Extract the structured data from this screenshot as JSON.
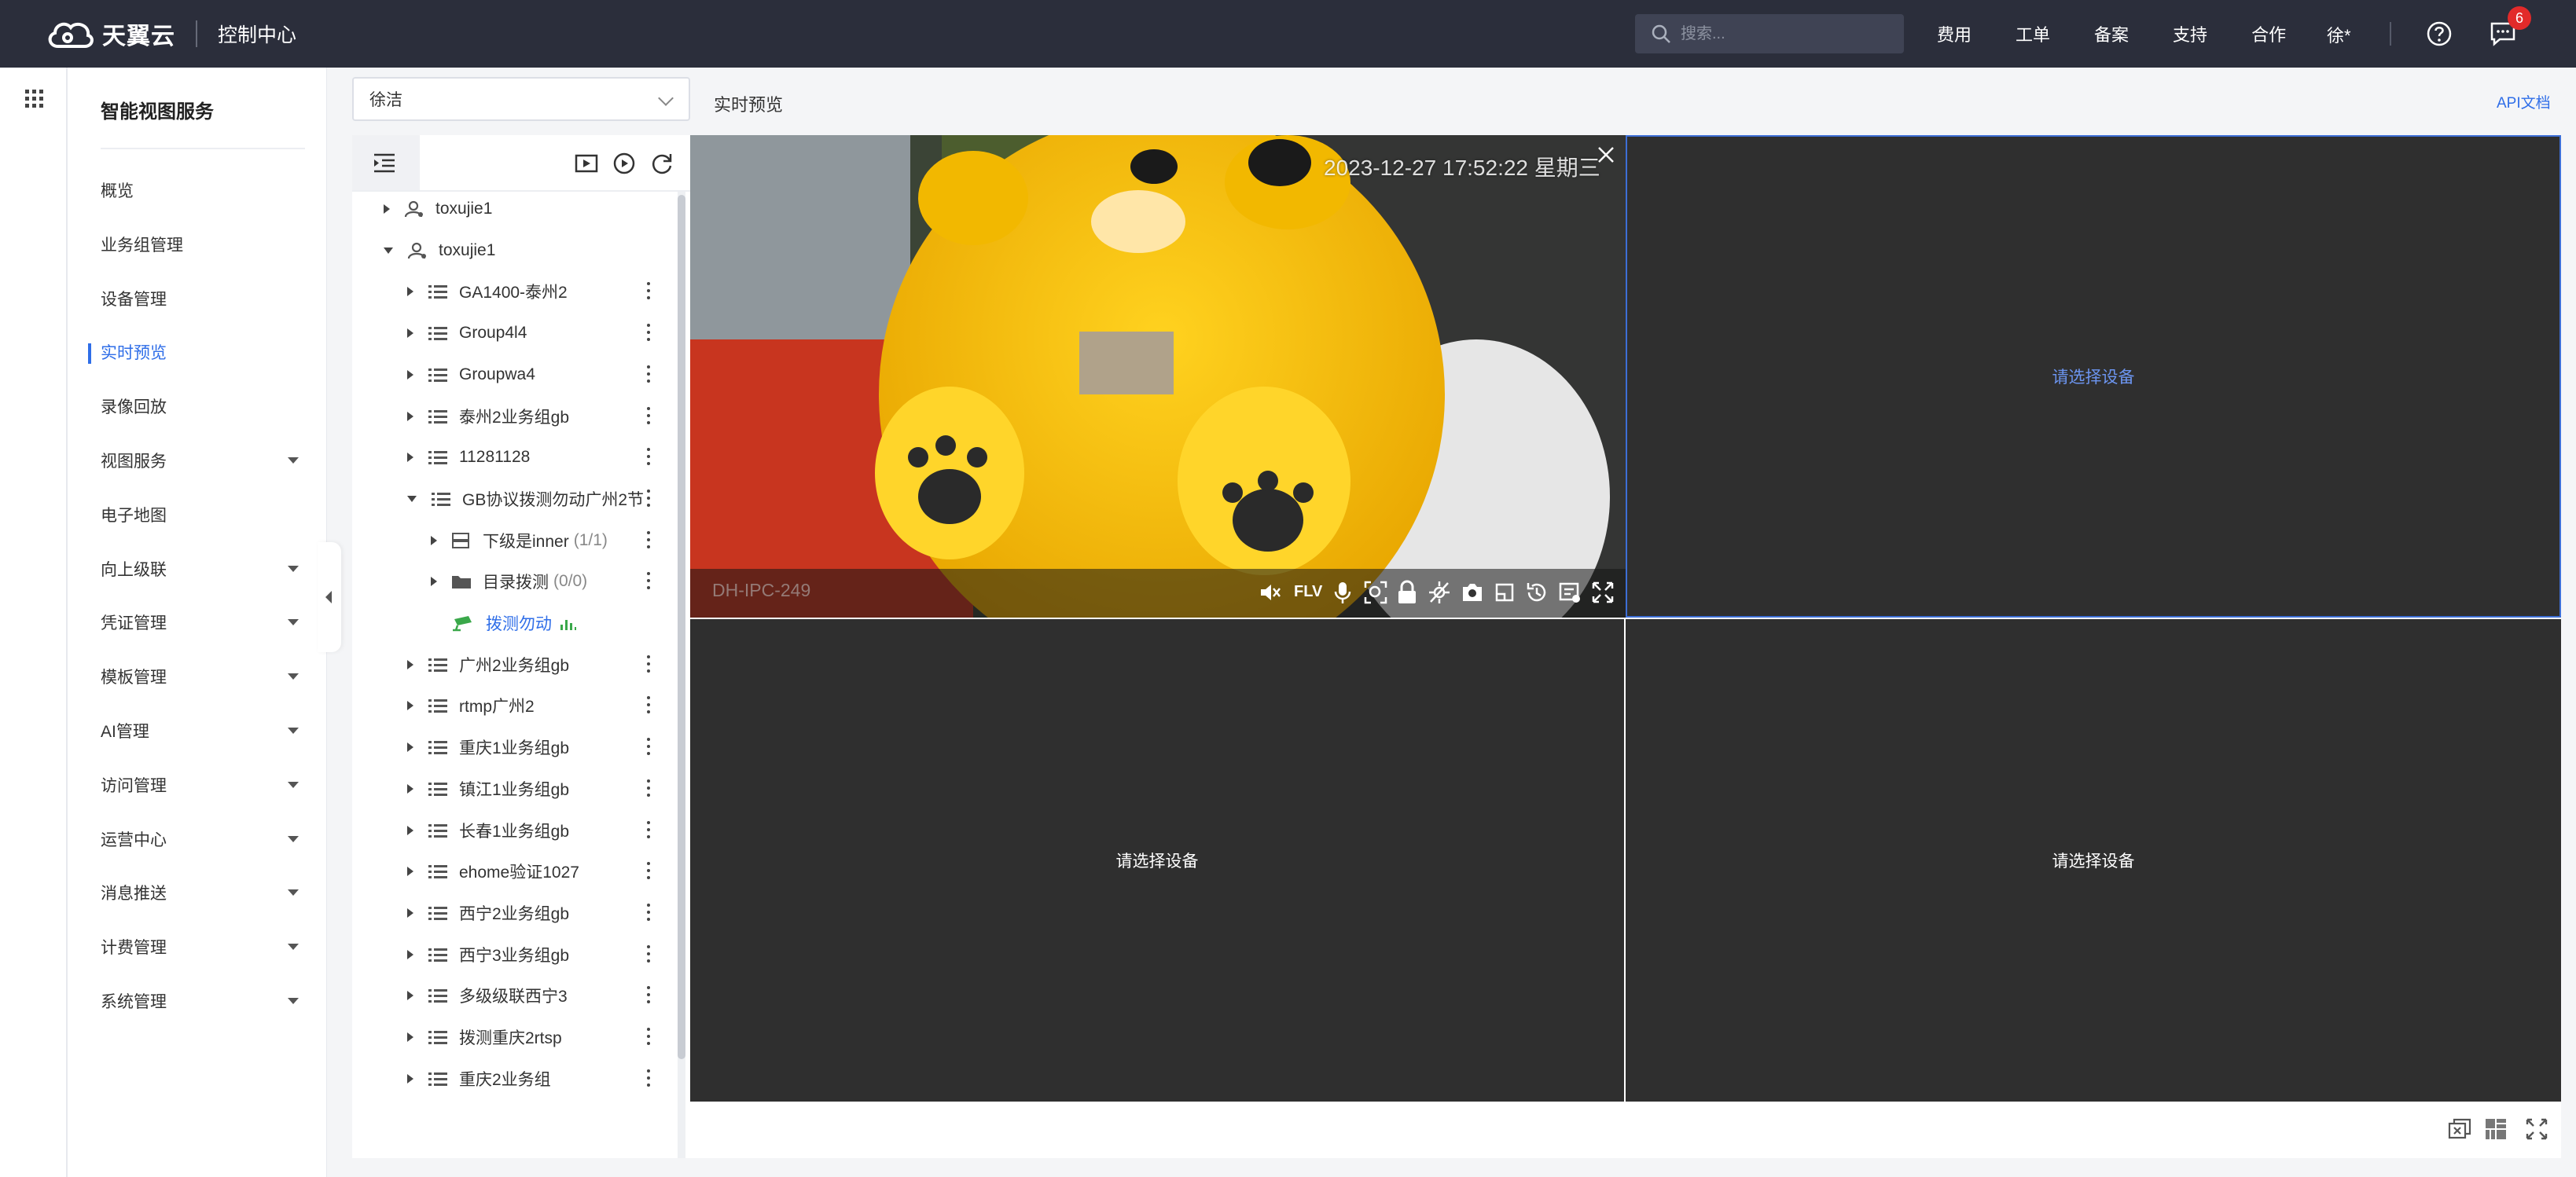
{
  "header": {
    "brand": "天翼云",
    "console_title": "控制中心",
    "search_placeholder": "搜索...",
    "nav": [
      "费用",
      "工单",
      "备案",
      "支持",
      "合作"
    ],
    "user": "徐*",
    "notification_count": "6"
  },
  "sidebar": {
    "title": "智能视图服务",
    "items": [
      {
        "label": "概览",
        "expandable": false
      },
      {
        "label": "业务组管理",
        "expandable": false
      },
      {
        "label": "设备管理",
        "expandable": false
      },
      {
        "label": "实时预览",
        "expandable": false,
        "active": true
      },
      {
        "label": "录像回放",
        "expandable": false
      },
      {
        "label": "视图服务",
        "expandable": true
      },
      {
        "label": "电子地图",
        "expandable": false
      },
      {
        "label": "向上级联",
        "expandable": true
      },
      {
        "label": "凭证管理",
        "expandable": true
      },
      {
        "label": "模板管理",
        "expandable": true
      },
      {
        "label": "AI管理",
        "expandable": true
      },
      {
        "label": "访问管理",
        "expandable": true
      },
      {
        "label": "运营中心",
        "expandable": true
      },
      {
        "label": "消息推送",
        "expandable": true
      },
      {
        "label": "计费管理",
        "expandable": true
      },
      {
        "label": "系统管理",
        "expandable": true
      }
    ]
  },
  "device_panel": {
    "selected_org": "徐洁",
    "tree": [
      {
        "label": "toxujie1",
        "level": 0,
        "icon": "user-icon",
        "state": "collapsed"
      },
      {
        "label": "toxujie1",
        "level": 0,
        "icon": "user-icon",
        "state": "expanded"
      },
      {
        "label": "GA1400-泰州2",
        "level": 1,
        "icon": "list-icon",
        "state": "collapsed"
      },
      {
        "label": "Group4l4",
        "level": 1,
        "icon": "list-icon",
        "state": "collapsed"
      },
      {
        "label": "Groupwa4",
        "level": 1,
        "icon": "list-icon",
        "state": "collapsed"
      },
      {
        "label": "泰州2业务组gb",
        "level": 1,
        "icon": "list-icon",
        "state": "collapsed"
      },
      {
        "label": "11281128",
        "level": 1,
        "icon": "list-icon",
        "state": "collapsed"
      },
      {
        "label": "GB协议拨测勿动广州2节",
        "level": 1,
        "icon": "list-icon",
        "state": "expanded"
      },
      {
        "label": "下级是inner",
        "count": "(1/1)",
        "level": 2,
        "icon": "server-icon",
        "state": "collapsed"
      },
      {
        "label": "目录拨测",
        "count": "(0/0)",
        "level": 2,
        "icon": "folder-icon",
        "state": "collapsed"
      },
      {
        "label": "拨测勿动",
        "level": 2,
        "icon": "camera-icon",
        "state": "leaf"
      },
      {
        "label": "广州2业务组gb",
        "level": 1,
        "icon": "list-icon",
        "state": "collapsed"
      },
      {
        "label": "rtmp广州2",
        "level": 1,
        "icon": "list-icon",
        "state": "collapsed"
      },
      {
        "label": "重庆1业务组gb",
        "level": 1,
        "icon": "list-icon",
        "state": "collapsed"
      },
      {
        "label": "镇江1业务组gb",
        "level": 1,
        "icon": "list-icon",
        "state": "collapsed"
      },
      {
        "label": "长春1业务组gb",
        "level": 1,
        "icon": "list-icon",
        "state": "collapsed"
      },
      {
        "label": "ehome验证1027",
        "level": 1,
        "icon": "list-icon",
        "state": "collapsed"
      },
      {
        "label": "西宁2业务组gb",
        "level": 1,
        "icon": "list-icon",
        "state": "collapsed"
      },
      {
        "label": "西宁3业务组gb",
        "level": 1,
        "icon": "list-icon",
        "state": "collapsed"
      },
      {
        "label": "多级级联西宁3",
        "level": 1,
        "icon": "list-icon",
        "state": "collapsed"
      },
      {
        "label": "拨测重庆2rtsp",
        "level": 1,
        "icon": "list-icon",
        "state": "collapsed"
      },
      {
        "label": "重庆2业务组",
        "level": 1,
        "icon": "list-icon",
        "state": "collapsed"
      }
    ]
  },
  "preview": {
    "title": "实时预览",
    "api_link": "API文档",
    "video": {
      "timestamp": "2023-12-27 17:52:22 星期三",
      "camera_name": "DH-IPC-249",
      "stream_format": "FLV"
    },
    "placeholder": "请选择设备",
    "colors": {
      "accent": "#2f6ee8",
      "cell_bg": "#2f2f2f",
      "topbar": "#2b2e3b"
    }
  }
}
